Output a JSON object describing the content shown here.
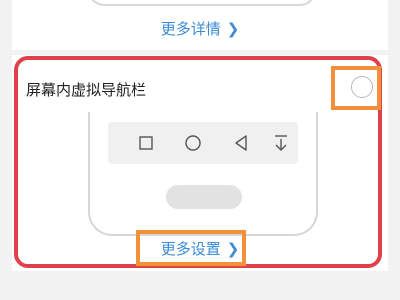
{
  "top_card": {
    "link_label": "更多详情",
    "link_chevron": "❯"
  },
  "option": {
    "title": "屏幕内虚拟导航栏",
    "radio_icon": "radio-unchecked-icon",
    "nav_icons": [
      "square-icon",
      "circle-icon",
      "back-triangle-icon",
      "notification-pull-icon"
    ],
    "more_label": "更多设置",
    "more_chevron": "❯"
  },
  "colors": {
    "link": "#3b8bd6",
    "annotation_outline": "#e0404a",
    "annotation_highlight": "#f2913a"
  }
}
